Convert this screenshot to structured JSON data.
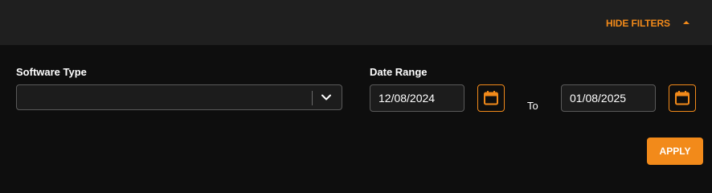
{
  "header": {
    "hide_filters_label": "HIDE FILTERS",
    "toggle_icon": "caret-up-icon"
  },
  "filters": {
    "software_type": {
      "label": "Software Type",
      "value": "",
      "icon": "chevron-down-icon"
    },
    "date_range": {
      "label": "Date Range",
      "start": "12/08/2024",
      "to_label": "To",
      "end": "01/08/2025",
      "icon": "calendar-icon"
    },
    "apply_label": "APPLY"
  },
  "colors": {
    "accent": "#f28a1a",
    "background": "#0e0e0e",
    "header_background": "#1f1f1f",
    "field_background": "#1c1c1c",
    "border": "#5a5a5a"
  }
}
